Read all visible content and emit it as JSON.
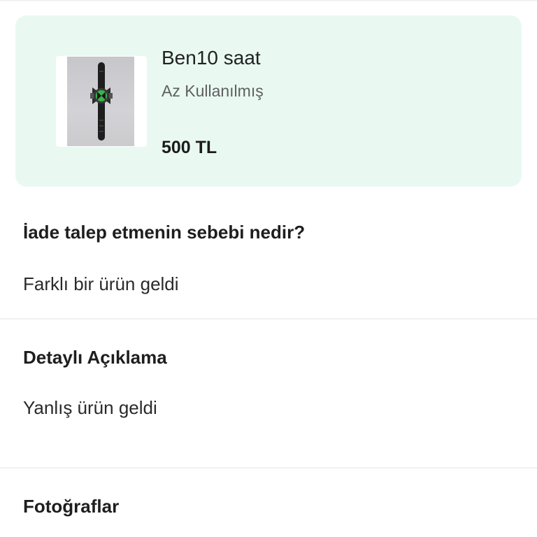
{
  "product": {
    "title": "Ben10 saat",
    "condition": "Az Kullanılmış",
    "price": "500 TL",
    "image_icon": "watch-product-photo"
  },
  "return_reason": {
    "heading": "İade talep etmenin sebebi nedir?",
    "value": "Farklı bir ürün geldi"
  },
  "description": {
    "heading": "Detaylı Açıklama",
    "value": "Yanlış ürün geldi"
  },
  "photos": {
    "heading": "Fotoğraflar"
  },
  "colors": {
    "card_background": "#e9f9f2",
    "divider": "#f0f0f0",
    "text_primary": "#1e1e1e",
    "text_secondary": "#5f5f5f"
  }
}
